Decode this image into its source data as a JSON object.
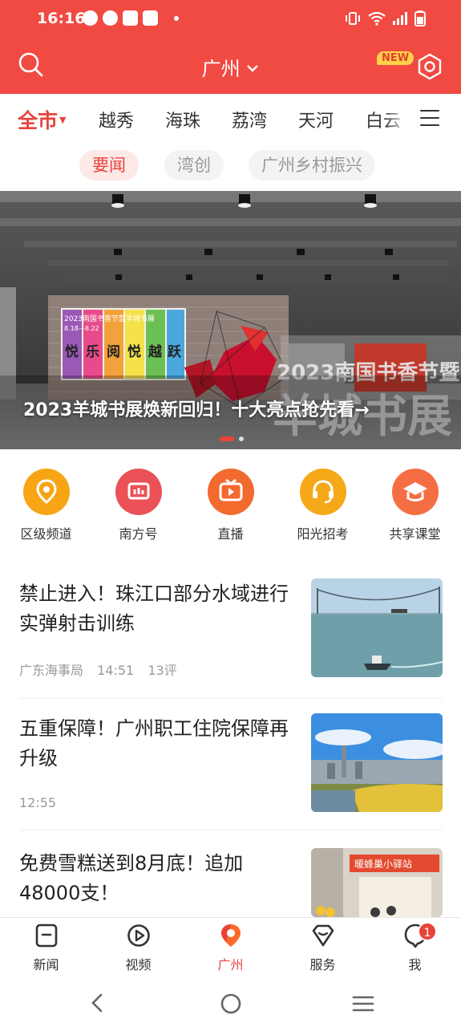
{
  "status_bar": {
    "time": "16:16"
  },
  "header": {
    "city": "广州",
    "new_badge": "NEW"
  },
  "district_tabs": [
    {
      "label": "全市",
      "active": true
    },
    {
      "label": "越秀"
    },
    {
      "label": "海珠"
    },
    {
      "label": "荔湾"
    },
    {
      "label": "天河"
    },
    {
      "label": "白云"
    }
  ],
  "sub_tags": [
    {
      "label": "要闻",
      "active": true
    },
    {
      "label": "湾创"
    },
    {
      "label": "广州乡村振兴"
    }
  ],
  "banner": {
    "caption": "2023羊城书展焕新回归！十大亮点抢先看→",
    "sign_text": "2023南国书香节暨",
    "sign_big": "羊城书展",
    "poster_text": "2023南国书香节暨羊城书展",
    "poster_dates": "8.18—8.22",
    "poster_slogan": [
      "悦",
      "乐",
      "阅",
      "悦",
      "越",
      "跃"
    ],
    "page_count": 2,
    "active_page": 1
  },
  "quick_entries": [
    {
      "label": "区级频道",
      "icon": "location-pin-icon",
      "color": "#f7a515"
    },
    {
      "label": "南方号",
      "icon": "chart-card-icon",
      "color": "#ea5257"
    },
    {
      "label": "直播",
      "icon": "tv-play-icon",
      "color": "#f26a2e"
    },
    {
      "label": "阳光招考",
      "icon": "headset-icon",
      "color": "#f5a818"
    },
    {
      "label": "共享课堂",
      "icon": "graduation-cap-icon",
      "color": "#f56e43"
    }
  ],
  "news": [
    {
      "title": "禁止进入！珠江口部分水域进行实弹射击训练",
      "source": "广东海事局",
      "time": "14:51",
      "comments": "13评"
    },
    {
      "title": "五重保障！广州职工住院保障再升级",
      "time": "12:55"
    },
    {
      "title": "免费雪糕送到8月底！追加48000支！",
      "shop_sign": "暖蜂巢小驿站"
    }
  ],
  "bottom_nav": [
    {
      "label": "新闻"
    },
    {
      "label": "视频"
    },
    {
      "label": "广州",
      "active": true
    },
    {
      "label": "服务"
    },
    {
      "label": "我"
    }
  ],
  "notification_count": "1"
}
